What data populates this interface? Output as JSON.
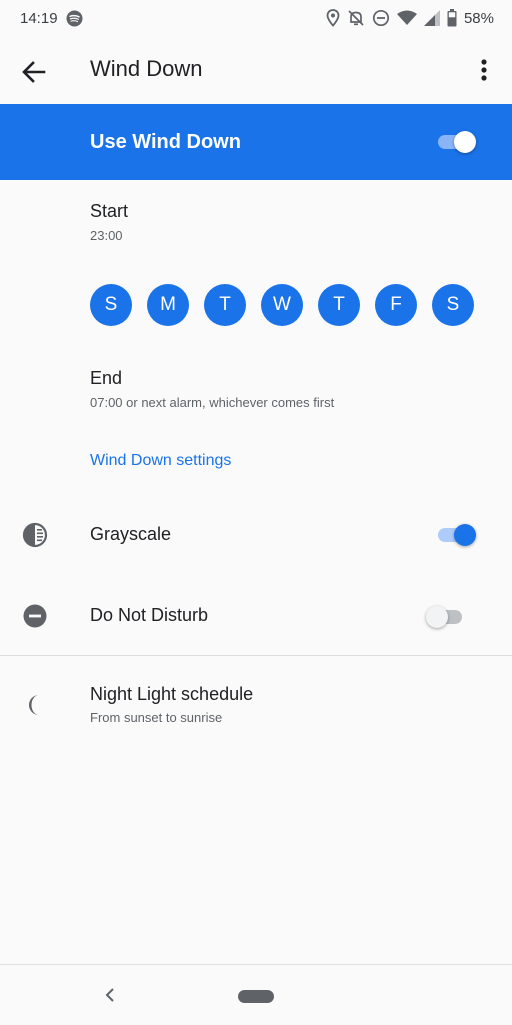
{
  "status_bar": {
    "time": "14:19",
    "battery": "58%",
    "icons": [
      "spotify-icon",
      "location-icon",
      "alarm-off-icon",
      "dnd-icon",
      "wifi-icon",
      "signal-icon",
      "battery-icon"
    ]
  },
  "app_bar": {
    "title": "Wind Down",
    "back_icon": "arrow-back-icon",
    "menu_icon": "more-vert-icon"
  },
  "master_switch": {
    "label": "Use Wind Down",
    "on": true
  },
  "start": {
    "title": "Start",
    "value": "23:00"
  },
  "days": [
    {
      "letter": "S",
      "selected": true
    },
    {
      "letter": "M",
      "selected": true
    },
    {
      "letter": "T",
      "selected": true
    },
    {
      "letter": "W",
      "selected": true
    },
    {
      "letter": "T",
      "selected": true
    },
    {
      "letter": "F",
      "selected": true
    },
    {
      "letter": "S",
      "selected": true
    }
  ],
  "end": {
    "title": "End",
    "value": "07:00 or next alarm, whichever comes first"
  },
  "settings_link": "Wind Down settings",
  "grayscale": {
    "label": "Grayscale",
    "icon": "contrast-icon",
    "on": true
  },
  "dnd": {
    "label": "Do Not Disturb",
    "icon": "do-not-disturb-icon",
    "on": false
  },
  "night_light": {
    "title": "Night Light schedule",
    "subtitle": "From sunset to sunrise",
    "icon": "moon-icon"
  },
  "colors": {
    "accent": "#1a73e8",
    "text_primary": "#202124",
    "text_secondary": "#5f6368",
    "background": "#fafafa"
  }
}
